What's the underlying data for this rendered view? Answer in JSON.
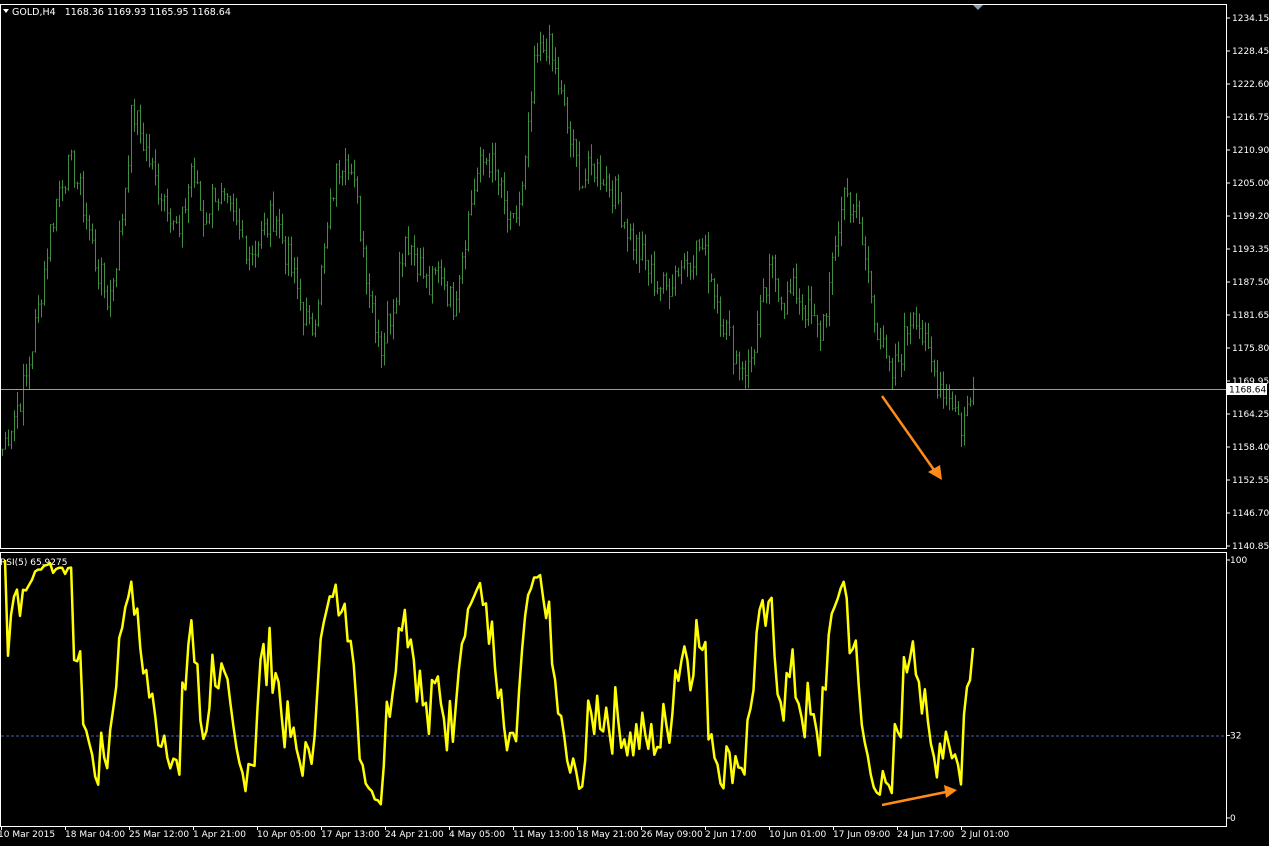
{
  "header": {
    "symbol": "GOLD,H4",
    "ohlc": "1168.36 1169.93 1165.95 1168.64"
  },
  "indicator_label": "RSI(5) 65.9275",
  "current_price_label": "1168.64",
  "colors": {
    "background": "#000000",
    "axis": "#ffffff",
    "price_bars": "#3f8f3f",
    "rsi_line": "#ffff00",
    "current_price_line": "#8aa0b0",
    "rsi_level_line": "#4a5fb0",
    "arrows": "#ff8c1a"
  },
  "chart_data": [
    {
      "type": "bar",
      "series": [
        {
          "values": []
        }
      ],
      "price_axis": {
        "ticks": [
          "1234.15",
          "1228.45",
          "1222.60",
          "1216.75",
          "1210.90",
          "1205.00",
          "1199.20",
          "1193.35",
          "1187.50",
          "1181.65",
          "1175.80",
          "1169.95",
          "1164.25",
          "1158.40",
          "1152.55",
          "1146.70",
          "1140.85"
        ],
        "ylim": [
          1140.85,
          1234.15
        ]
      },
      "close_series": [
        1158,
        1164,
        1170,
        1182,
        1196,
        1206,
        1208,
        1200,
        1190,
        1184,
        1196,
        1218,
        1212,
        1205,
        1202,
        1195,
        1208,
        1198,
        1204,
        1200,
        1196,
        1193,
        1196,
        1200,
        1192,
        1185,
        1178,
        1190,
        1205,
        1212,
        1200,
        1186,
        1176,
        1184,
        1196,
        1192,
        1186,
        1190,
        1183,
        1195,
        1206,
        1210,
        1204,
        1196,
        1204,
        1226,
        1230,
        1222,
        1212,
        1205,
        1208,
        1206,
        1202,
        1196,
        1192,
        1188,
        1186,
        1190,
        1192,
        1194,
        1188,
        1180,
        1174,
        1172,
        1182,
        1190,
        1184,
        1186,
        1182,
        1178,
        1188,
        1204,
        1200,
        1190,
        1178,
        1170,
        1176,
        1184,
        1175,
        1170,
        1168,
        1162,
        1168
      ],
      "annotations": [
        {
          "type": "arrow",
          "direction": "down",
          "color": "#ff8c1a"
        }
      ]
    },
    {
      "type": "line",
      "series": [
        {
          "name": "RSI(5)",
          "color": "#ffff00",
          "values": []
        }
      ],
      "ylim": [
        0,
        100
      ],
      "ticks": [
        "100",
        "32",
        "0"
      ],
      "level": 32,
      "annotations": [
        {
          "type": "arrow",
          "direction": "up",
          "color": "#ff8c1a"
        }
      ]
    }
  ],
  "time_axis": {
    "labels": [
      "10 Mar 2015",
      "18 Mar 04:00",
      "25 Mar 12:00",
      "1 Apr 21:00",
      "10 Apr 05:00",
      "17 Apr 13:00",
      "24 Apr 21:00",
      "4 May 05:00",
      "11 May 13:00",
      "18 May 21:00",
      "26 May 09:00",
      "2 Jun 17:00",
      "10 Jun 01:00",
      "17 Jun 09:00",
      "24 Jun 17:00",
      "2 Jul 01:00"
    ]
  }
}
